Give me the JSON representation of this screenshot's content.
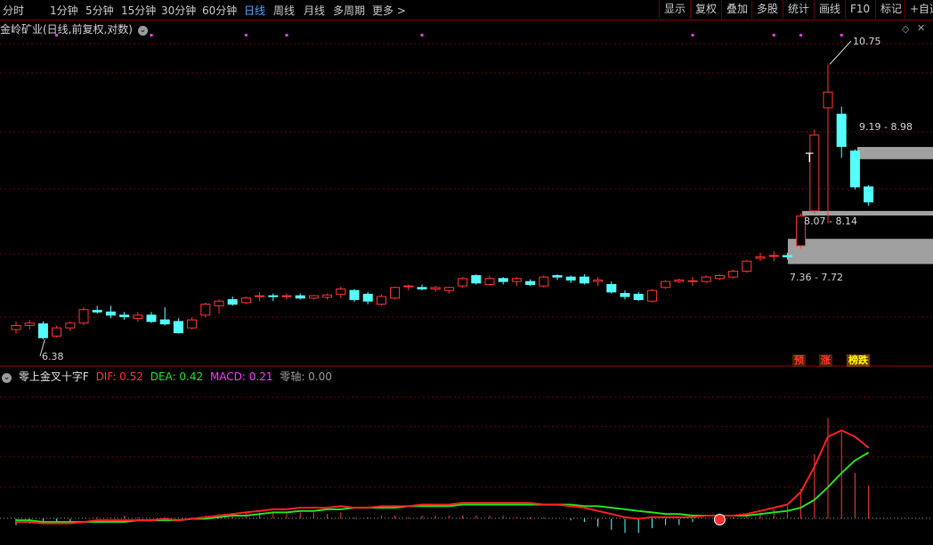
{
  "toolbar": {
    "periods": [
      "分时",
      "1分钟",
      "5分钟",
      "15分钟",
      "30分钟",
      "60分钟",
      "日线",
      "周线",
      "月线",
      "多周期",
      "更多"
    ],
    "active_period": "日线",
    "tools": [
      "显示",
      "复权",
      "叠加",
      "多股",
      "统计",
      "画线",
      "F10",
      "标记",
      "+自选"
    ]
  },
  "chart_title": "金岭矿业(日线,前复权,对数)",
  "price_labels": {
    "high": "10.75",
    "low": "6.38",
    "zone1": "9.19 - 8.98",
    "zone2": "8.07 - 8.14",
    "zone3": "7.36 - 7.72",
    "t_marker": "T"
  },
  "badges": [
    "预",
    "涨",
    "榜跌"
  ],
  "indicator": {
    "name": "零上金叉十字F",
    "dif_label": "DIF: 0.52",
    "dea_label": "DEA: 0.42",
    "macd_label": "MACD: 0.21",
    "zero_label": "零轴: 0.00"
  },
  "colors": {
    "up": "#ff3232",
    "down": "#54ffff",
    "dif": "#ff2020",
    "dea": "#20e020",
    "macd": "#ff33ff",
    "accent_blue": "#4fa3ff"
  },
  "chart_data": [
    {
      "type": "candlestick",
      "title": "金岭矿业(日线,前复权,对数)",
      "ohlc": [
        [
          6.5,
          6.6,
          6.45,
          6.55
        ],
        [
          6.55,
          6.62,
          6.5,
          6.58
        ],
        [
          6.57,
          6.6,
          6.38,
          6.4
        ],
        [
          6.42,
          6.55,
          6.4,
          6.52
        ],
        [
          6.52,
          6.6,
          6.48,
          6.58
        ],
        [
          6.58,
          6.78,
          6.55,
          6.75
        ],
        [
          6.74,
          6.8,
          6.7,
          6.72
        ],
        [
          6.72,
          6.8,
          6.64,
          6.68
        ],
        [
          6.68,
          6.72,
          6.62,
          6.66
        ],
        [
          6.64,
          6.72,
          6.6,
          6.68
        ],
        [
          6.68,
          6.72,
          6.58,
          6.6
        ],
        [
          6.62,
          6.78,
          6.55,
          6.57
        ],
        [
          6.6,
          6.64,
          6.45,
          6.46
        ],
        [
          6.52,
          6.65,
          6.5,
          6.62
        ],
        [
          6.68,
          6.84,
          6.65,
          6.82
        ],
        [
          6.8,
          6.88,
          6.7,
          6.86
        ],
        [
          6.88,
          6.92,
          6.8,
          6.82
        ],
        [
          6.84,
          6.92,
          6.82,
          6.9
        ],
        [
          6.92,
          6.98,
          6.86,
          6.93
        ],
        [
          6.93,
          6.96,
          6.86,
          6.92
        ],
        [
          6.92,
          6.96,
          6.88,
          6.93
        ],
        [
          6.93,
          6.96,
          6.88,
          6.9
        ],
        [
          6.9,
          6.94,
          6.88,
          6.93
        ],
        [
          6.91,
          6.96,
          6.88,
          6.94
        ],
        [
          6.95,
          7.05,
          6.9,
          7.02
        ],
        [
          7.0,
          7.02,
          6.85,
          6.88
        ],
        [
          6.95,
          6.98,
          6.82,
          6.86
        ],
        [
          6.82,
          6.95,
          6.8,
          6.92
        ],
        [
          6.9,
          7.05,
          6.88,
          7.04
        ],
        [
          7.05,
          7.08,
          7.0,
          7.06
        ],
        [
          7.04,
          7.08,
          7.0,
          7.02
        ],
        [
          7.02,
          7.06,
          6.98,
          7.04
        ],
        [
          7.0,
          7.05,
          6.96,
          7.04
        ],
        [
          7.06,
          7.18,
          7.04,
          7.16
        ],
        [
          7.2,
          7.22,
          7.08,
          7.1
        ],
        [
          7.08,
          7.2,
          7.06,
          7.16
        ],
        [
          7.16,
          7.18,
          7.08,
          7.12
        ],
        [
          7.12,
          7.18,
          7.06,
          7.16
        ],
        [
          7.12,
          7.15,
          7.06,
          7.08
        ],
        [
          7.06,
          7.2,
          7.04,
          7.18
        ],
        [
          7.2,
          7.22,
          7.14,
          7.18
        ],
        [
          7.18,
          7.2,
          7.1,
          7.14
        ],
        [
          7.18,
          7.22,
          7.08,
          7.1
        ],
        [
          7.12,
          7.18,
          7.06,
          7.14
        ],
        [
          7.08,
          7.12,
          6.96,
          6.98
        ],
        [
          6.96,
          7.0,
          6.88,
          6.92
        ],
        [
          6.95,
          6.98,
          6.86,
          6.88
        ],
        [
          6.86,
          7.02,
          6.84,
          7.0
        ],
        [
          7.04,
          7.14,
          7.02,
          7.12
        ],
        [
          7.12,
          7.16,
          7.1,
          7.14
        ],
        [
          7.12,
          7.18,
          7.06,
          7.13
        ],
        [
          7.12,
          7.2,
          7.1,
          7.18
        ],
        [
          7.16,
          7.22,
          7.14,
          7.2
        ],
        [
          7.18,
          7.28,
          7.16,
          7.26
        ],
        [
          7.26,
          7.42,
          7.24,
          7.4
        ],
        [
          7.44,
          7.52,
          7.4,
          7.46
        ],
        [
          7.48,
          7.54,
          7.4,
          7.48
        ],
        [
          7.48,
          7.52,
          7.42,
          7.46
        ],
        [
          7.62,
          8.1,
          7.58,
          8.06
        ],
        [
          8.14,
          9.5,
          8.1,
          9.4
        ],
        [
          9.9,
          10.75,
          7.95,
          10.2
        ],
        [
          9.78,
          9.92,
          9.0,
          9.2
        ],
        [
          9.12,
          9.15,
          8.48,
          8.52
        ],
        [
          8.52,
          8.55,
          8.22,
          8.28
        ]
      ],
      "y_scale": "log",
      "y_range": [
        6.2,
        11.2
      ],
      "annotations": [
        "10.75",
        "6.38",
        "9.19 - 8.98",
        "8.07 - 8.14",
        "7.36 - 7.72"
      ]
    },
    {
      "type": "line",
      "title": "零上金叉十字F",
      "series": [
        {
          "name": "DIF",
          "values": [
            -0.02,
            -0.02,
            -0.03,
            -0.03,
            -0.03,
            -0.02,
            -0.01,
            -0.01,
            -0.01,
            -0.01,
            -0.01,
            0.0,
            -0.01,
            0.0,
            0.01,
            0.02,
            0.03,
            0.04,
            0.05,
            0.06,
            0.06,
            0.07,
            0.07,
            0.07,
            0.08,
            0.07,
            0.07,
            0.08,
            0.08,
            0.08,
            0.09,
            0.09,
            0.09,
            0.1,
            0.1,
            0.1,
            0.1,
            0.1,
            0.1,
            0.09,
            0.09,
            0.08,
            0.07,
            0.05,
            0.03,
            0.01,
            0.0,
            0.01,
            0.01,
            0.01,
            0.01,
            0.02,
            0.02,
            0.02,
            0.03,
            0.05,
            0.07,
            0.09,
            0.17,
            0.33,
            0.52,
            0.56,
            0.52,
            0.45
          ]
        },
        {
          "name": "DEA",
          "values": [
            -0.01,
            -0.01,
            -0.02,
            -0.02,
            -0.02,
            -0.02,
            -0.02,
            -0.02,
            -0.02,
            -0.01,
            -0.01,
            -0.01,
            -0.01,
            0.0,
            0.0,
            0.01,
            0.02,
            0.02,
            0.03,
            0.04,
            0.04,
            0.05,
            0.05,
            0.06,
            0.06,
            0.07,
            0.07,
            0.07,
            0.07,
            0.08,
            0.08,
            0.08,
            0.08,
            0.09,
            0.09,
            0.09,
            0.09,
            0.09,
            0.09,
            0.09,
            0.09,
            0.09,
            0.08,
            0.08,
            0.07,
            0.06,
            0.05,
            0.04,
            0.03,
            0.03,
            0.02,
            0.02,
            0.02,
            0.02,
            0.02,
            0.03,
            0.04,
            0.05,
            0.07,
            0.12,
            0.2,
            0.29,
            0.37,
            0.42
          ]
        },
        {
          "name": "MACD",
          "values": [
            -0.04,
            -0.03,
            -0.02,
            -0.02,
            -0.02,
            0.0,
            0.01,
            0.01,
            0.02,
            0.01,
            0.0,
            0.01,
            0.0,
            0.01,
            0.02,
            0.03,
            0.03,
            0.04,
            0.04,
            0.04,
            0.04,
            0.04,
            0.04,
            0.03,
            0.04,
            0.01,
            0.01,
            0.02,
            0.02,
            0.01,
            0.02,
            0.02,
            0.02,
            0.02,
            0.02,
            0.02,
            0.02,
            0.01,
            0.01,
            0.01,
            0.0,
            -0.01,
            -0.02,
            -0.05,
            -0.07,
            -0.09,
            -0.09,
            -0.06,
            -0.04,
            -0.04,
            -0.02,
            0.0,
            0.01,
            0.01,
            0.02,
            0.04,
            0.06,
            0.08,
            0.19,
            0.41,
            0.64,
            0.55,
            0.29,
            0.21
          ]
        }
      ],
      "y_range": [
        -0.11,
        0.85
      ]
    }
  ]
}
